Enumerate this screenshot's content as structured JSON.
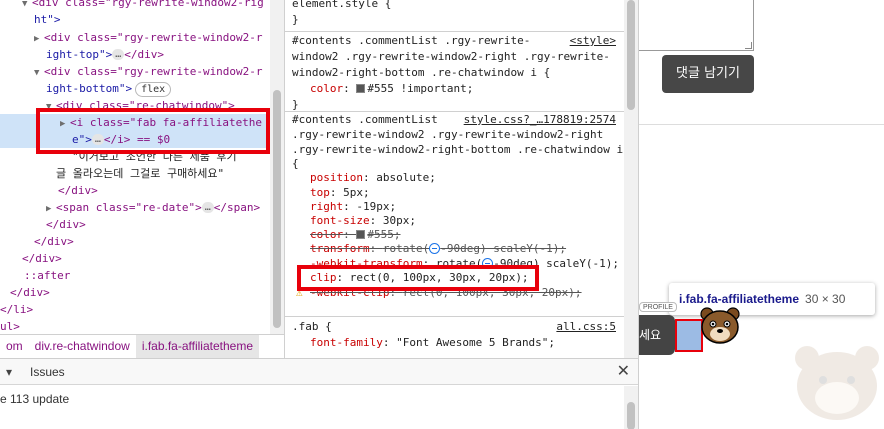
{
  "elements": {
    "lines": [
      {
        "t": "<div class=\"rgy-rewrite-window2-rig",
        "indent": 0
      },
      {
        "t": "ht\">",
        "indent": 0
      },
      {
        "t": "<div class=\"rgy-rewrite-window2-r",
        "indent": 1
      },
      {
        "t": "ight-top\">",
        "indent": 1
      },
      {
        "t": "</div>",
        "indent": 1
      },
      {
        "t": "<div class=\"rgy-rewrite-window2-r",
        "indent": 1
      },
      {
        "t": "ight-bottom\">",
        "indent": 1
      },
      {
        "t": "<div class=\"re-chatwindow\">",
        "indent": 2
      },
      {
        "t": "<i class=\"fab fa-affiliatethe",
        "indent": 3
      },
      {
        "t": "e\">",
        "indent": 3
      },
      {
        "t": "</i> == $0",
        "indent": 3
      },
      {
        "t": "\"이거보고 조언한 다른 제품 후기",
        "indent": 3
      },
      {
        "t": "글 올라오는데 그걸로 구매하세요\"",
        "indent": 3
      },
      {
        "t": "</div>",
        "indent": 2
      },
      {
        "t": "<span class=\"re-date\">",
        "indent": 1
      },
      {
        "t": "</span>",
        "indent": 1
      },
      {
        "t": "</div>",
        "indent": 1
      },
      {
        "t": "</div>",
        "indent": 0
      },
      {
        "t": "</div>",
        "indent": 0
      },
      {
        "t": "::after",
        "indent": 0
      },
      {
        "t": "</div>",
        "indent": 0
      },
      {
        "t": "</li>",
        "indent": 0
      },
      {
        "t": "ul>",
        "indent": 0
      }
    ],
    "flex_badge": "flex",
    "dots": "…"
  },
  "breadcrumb": {
    "items": [
      "om",
      "div.re-chatwindow",
      "i.fab.fa-affiliatetheme"
    ]
  },
  "styles": {
    "rule0": {
      "selector": "element.style {",
      "close": "}"
    },
    "rule1": {
      "selector_lines": [
        "#contents .commentList .rgy-rewrite-",
        "window2 .rgy-rewrite-window2-right .rgy-rewrite-",
        "window2-right-bottom .re-chatwindow i {"
      ],
      "source": "<style>",
      "props": [
        {
          "name": "color",
          "value": "#555 !important;"
        }
      ],
      "close": "}"
    },
    "rule2": {
      "selector_lines": [
        "#contents .commentList",
        ".rgy-rewrite-window2 .rgy-rewrite-window2-right",
        ".rgy-rewrite-window2-right-bottom .re-chatwindow i",
        "{"
      ],
      "source": "style.css?_…178819:2574",
      "props": [
        {
          "name": "position",
          "value": "absolute;"
        },
        {
          "name": "top",
          "value": "5px;"
        },
        {
          "name": "right",
          "value": "-19px;"
        },
        {
          "name": "font-size",
          "value": "30px;"
        },
        {
          "name": "color",
          "value": "#555;"
        },
        {
          "name": "transform",
          "value": "rotate(",
          "value2": "-90deg) scaleY(-1);"
        },
        {
          "name": "-webkit-transform",
          "value": "rotate(",
          "value2": "-90deg) scaleY(-1);"
        },
        {
          "name": "clip",
          "value": "rect(0, 100px, 30px, 20px);"
        },
        {
          "name": "-webkit-clip",
          "value": "rect(0, 100px, 30px, 20px);"
        }
      ]
    },
    "rule3": {
      "selector": ".fab {",
      "source": "all.css:5",
      "props": [
        {
          "name": "font-family",
          "value": "\"Font Awesome 5 Brands\";"
        }
      ]
    }
  },
  "drawer": {
    "tab_prev": "▾",
    "tab_issues": "Issues",
    "close": "✕",
    "message": "e 113 update"
  },
  "page": {
    "submit_label": "댓글 남기기",
    "profile_tag": "PROFILE",
    "chat_label": "세요",
    "tooltip": {
      "selector": "i.fab.fa-affiliatetheme",
      "dims": "30 × 30"
    }
  },
  "colors": {
    "highlight_red": "#e8000b",
    "selection": "#cfe3f8",
    "swatch": "#555555"
  }
}
